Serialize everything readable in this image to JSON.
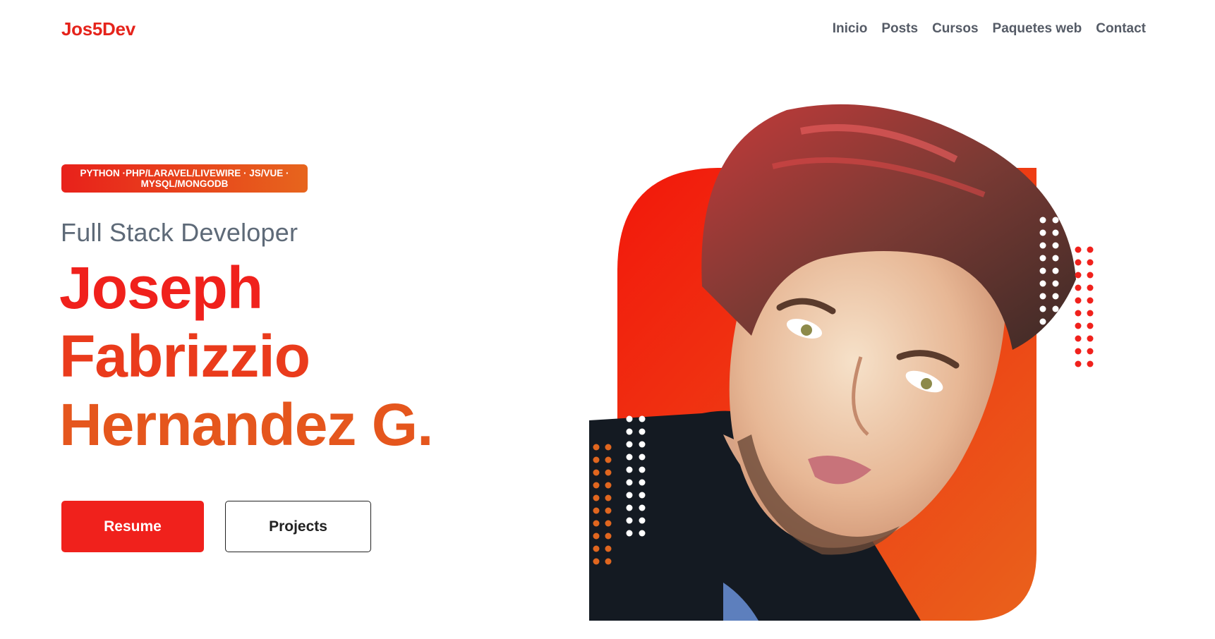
{
  "header": {
    "logo": "Jos5Dev",
    "nav": [
      "Inicio",
      "Posts",
      "Cursos",
      "Paquetes web",
      "Contact"
    ]
  },
  "hero": {
    "badge_line1": "PYTHON ·PHP/LARAVEL/LIVEWIRE · JS/VUE ·",
    "badge_line2": "MYSQL/MONGODB",
    "subtitle": "Full Stack Developer",
    "name_line1": "Joseph",
    "name_line2": "Fabrizzio",
    "name_line3": "Hernandez G.",
    "resume_label": "Resume",
    "projects_label": "Projects"
  },
  "colors": {
    "accent_red": "#f0211c",
    "accent_orange": "#e5561d",
    "nav_text": "#555b66"
  }
}
